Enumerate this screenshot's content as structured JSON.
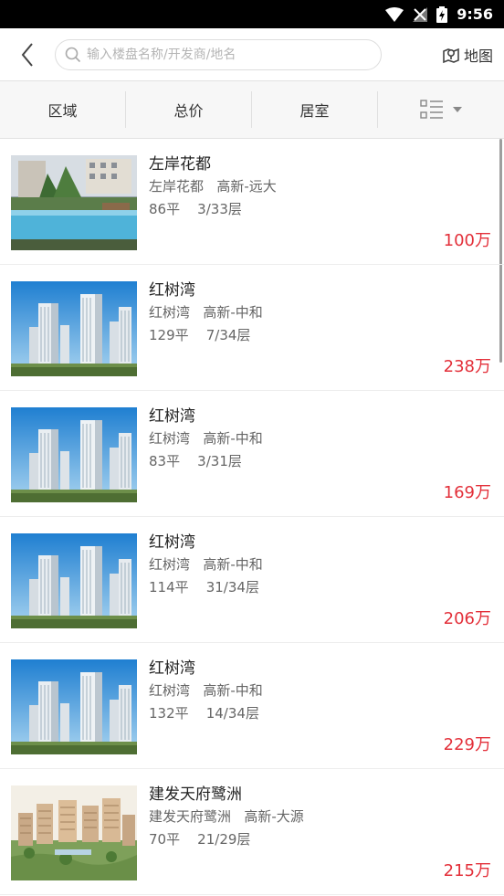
{
  "status_bar": {
    "time": "9:56"
  },
  "header": {
    "search_placeholder": "输入楼盘名称/开发商/地名",
    "map_label": "地图"
  },
  "filters": [
    {
      "label": "区域"
    },
    {
      "label": "总价"
    },
    {
      "label": "居室"
    }
  ],
  "listings": [
    {
      "title": "左岸花都",
      "community": "左岸花都",
      "district": "高新-远大",
      "area": "86平",
      "floor": "3/33层",
      "price": "100万",
      "image": "pool-icon"
    },
    {
      "title": "红树湾",
      "community": "红树湾",
      "district": "高新-中和",
      "area": "129平",
      "floor": "7/34层",
      "price": "238万",
      "image": "towers-icon"
    },
    {
      "title": "红树湾",
      "community": "红树湾",
      "district": "高新-中和",
      "area": "83平",
      "floor": "3/31层",
      "price": "169万",
      "image": "towers-icon"
    },
    {
      "title": "红树湾",
      "community": "红树湾",
      "district": "高新-中和",
      "area": "114平",
      "floor": "31/34层",
      "price": "206万",
      "image": "towers-icon"
    },
    {
      "title": "红树湾",
      "community": "红树湾",
      "district": "高新-中和",
      "area": "132平",
      "floor": "14/34层",
      "price": "229万",
      "image": "towers-icon"
    },
    {
      "title": "建发天府鹭洲",
      "community": "建发天府鹭洲",
      "district": "高新-大源",
      "area": "70平",
      "floor": "21/29层",
      "price": "215万",
      "image": "estate-icon"
    }
  ],
  "colors": {
    "price": "#e3303a",
    "accent_bar": "#000000"
  }
}
